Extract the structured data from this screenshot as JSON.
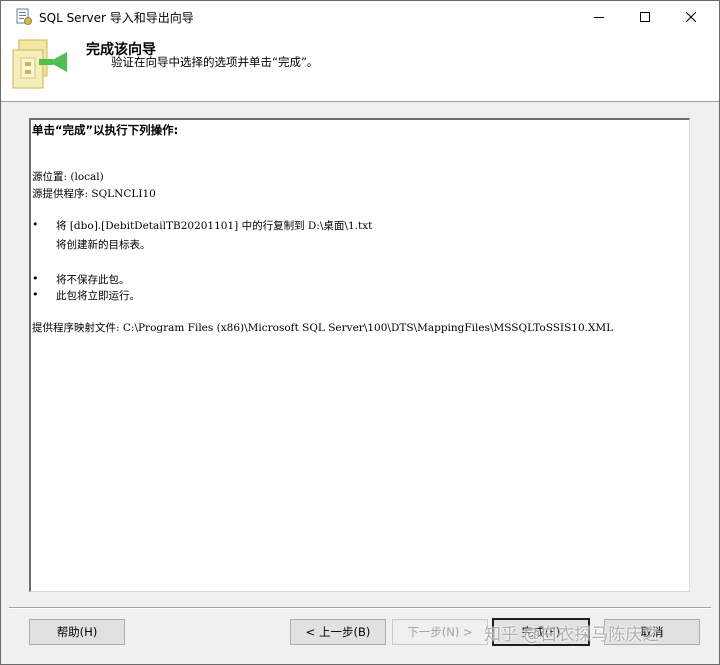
{
  "window": {
    "title": "SQL Server 导入和导出向导",
    "controls": {
      "minimize": "minimize-icon",
      "maximize": "maximize-icon",
      "close": "close-icon"
    }
  },
  "header": {
    "title": "完成该向导",
    "subtitle": "验证在向导中选择的选项并单击“完成”。",
    "icon": "wizard-banner-icon"
  },
  "summary": {
    "heading": "单击“完成”以执行下列操作:",
    "source_location": "源位置: (local)",
    "source_provider": "源提供程序: SQLNCLI10",
    "bullets": [
      {
        "text": "将 [dbo].[DebitDetailTB20201101] 中的行复制到 D:\\桌面\\1.txt",
        "sub": "将创建新的目标表。"
      },
      {
        "text": "将不保存此包。"
      },
      {
        "text": "此包将立即运行。"
      }
    ],
    "bullet_char": "•",
    "mapping_file": "提供程序映射文件: C:\\Program Files (x86)\\Microsoft SQL Server\\100\\DTS\\MappingFiles\\MSSQLToSSIS10.XML"
  },
  "buttons": {
    "help": "帮助(H)",
    "back": "< 上一步(B)",
    "next": "下一步(N) >",
    "finish": "完成(F)",
    "cancel": "取消"
  },
  "watermark": "知乎 @白衣探马陈庆之"
}
